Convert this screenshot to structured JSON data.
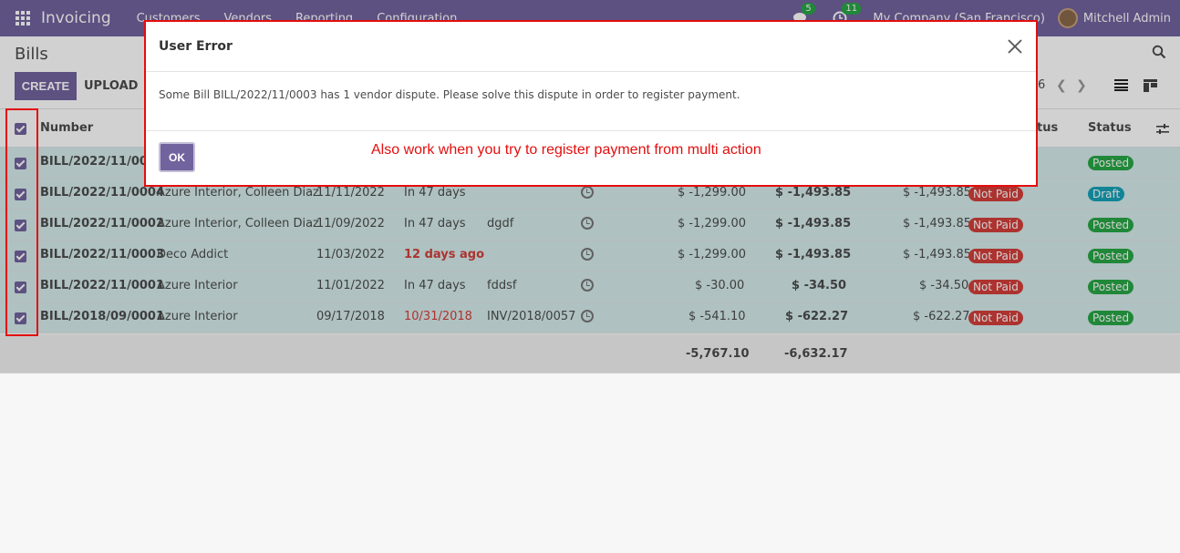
{
  "navbar": {
    "app_name": "Invoicing",
    "menu": [
      "Customers",
      "Vendors",
      "Reporting",
      "Configuration"
    ],
    "chat_count": "5",
    "activity_count": "11",
    "company": "My Company (San Francisco)",
    "user": "Mitchell Admin"
  },
  "control_panel": {
    "title": "Bills",
    "create_label": "CREATE",
    "upload_label": "UPLOAD",
    "pager": "6"
  },
  "table": {
    "headers": {
      "number": "Number",
      "payment_status": "tus",
      "status": "Status"
    },
    "rows": [
      {
        "number": "BILL/2022/11/0005",
        "vendor": "",
        "bill_date": "",
        "due": "",
        "reference": "",
        "untaxed": "",
        "total": "",
        "amount_due": "",
        "payment": "",
        "status": "Posted",
        "due_red": false
      },
      {
        "number": "BILL/2022/11/0004",
        "vendor": "Azure Interior, Colleen Diaz",
        "bill_date": "11/11/2022",
        "due": "In 47 days",
        "reference": "",
        "untaxed": "$ -1,299.00",
        "total": "$ -1,493.85",
        "amount_due": "$ -1,493.85",
        "payment": "Not Paid",
        "status": "Draft",
        "due_red": false
      },
      {
        "number": "BILL/2022/11/0002",
        "vendor": "Azure Interior, Colleen Diaz",
        "bill_date": "11/09/2022",
        "due": "In 47 days",
        "reference": "dgdf",
        "untaxed": "$ -1,299.00",
        "total": "$ -1,493.85",
        "amount_due": "$ -1,493.85",
        "payment": "Not Paid",
        "status": "Posted",
        "due_red": false
      },
      {
        "number": "BILL/2022/11/0003",
        "vendor": "Deco Addict",
        "bill_date": "11/03/2022",
        "due": "12 days ago",
        "reference": "",
        "untaxed": "$ -1,299.00",
        "total": "$ -1,493.85",
        "amount_due": "$ -1,493.85",
        "payment": "Not Paid",
        "status": "Posted",
        "due_red": true
      },
      {
        "number": "BILL/2022/11/0001",
        "vendor": "Azure Interior",
        "bill_date": "11/01/2022",
        "due": "In 47 days",
        "reference": "fddsf",
        "untaxed": "$ -30.00",
        "total": "$ -34.50",
        "amount_due": "$ -34.50",
        "payment": "Not Paid",
        "status": "Posted",
        "due_red": false
      },
      {
        "number": "BILL/2018/09/0001",
        "vendor": "Azure Interior",
        "bill_date": "09/17/2018",
        "due": "10/31/2018",
        "reference": "INV/2018/0057",
        "untaxed": "$ -541.10",
        "total": "$ -622.27",
        "amount_due": "$ -622.27",
        "payment": "Not Paid",
        "status": "Posted",
        "due_red": true
      }
    ],
    "totals": {
      "untaxed": "-5,767.10",
      "total": "-6,632.17"
    }
  },
  "modal": {
    "title": "User Error",
    "message": "Some Bill BILL/2022/11/0003 has 1 vendor dispute. Please solve this dispute in order to register payment.",
    "ok_label": "OK"
  },
  "annotation": {
    "note": "Also work when you try to register payment from multi action"
  },
  "colors": {
    "brand": "#71639e",
    "annotation_red": "#e30e0e",
    "not_paid": "#d23f3a",
    "posted": "#28a745",
    "draft": "#17a2b8"
  }
}
